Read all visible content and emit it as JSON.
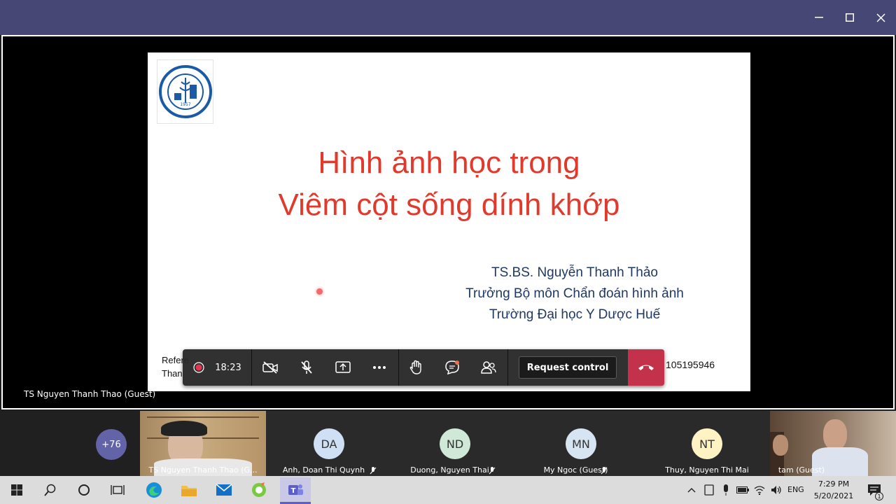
{
  "slide": {
    "title_line1": "Hình ảnh học trong",
    "title_line2": "Viêm cột sống dính khớp",
    "author_line1": "TS.BS. Nguyễn Thanh Thảo",
    "author_line2": "Trưởng Bộ môn Chẩn đoán hình ảnh",
    "author_line3": "Trường Đại học Y Dược Huế",
    "ref_line1": "Refere",
    "ref_line2": "Than",
    "phone": "105195946",
    "logo_year": "1957"
  },
  "presenter": {
    "name": "TS Nguyen Thanh Thao (Guest)"
  },
  "call_bar": {
    "timer": "18:23",
    "request_control": "Request control"
  },
  "participants": {
    "overflow": "+76",
    "tiles": [
      {
        "initials": "",
        "name": "TS Nguyen Thanh Thao (G..."
      },
      {
        "initials": "DA",
        "name": "Anh, Doan Thi Quynh",
        "color": "#cfe0f5"
      },
      {
        "initials": "ND",
        "name": "Duong, Nguyen Thai",
        "color": "#cfe8d7"
      },
      {
        "initials": "MN",
        "name": "My Ngoc (Guest)",
        "color": "#d7e5f2"
      },
      {
        "initials": "NT",
        "name": "Thuy, Nguyen Thi Mai",
        "color": "#fff3c4"
      },
      {
        "initials": "",
        "name": "tam (Guest)"
      }
    ]
  },
  "taskbar": {
    "time": "7:29 PM",
    "date": "5/20/2021",
    "language": "ENG",
    "notification_count": "1"
  },
  "colors": {
    "titlebar": "#464775",
    "accent_red": "#e03a2c",
    "hangup": "#c4314b"
  }
}
